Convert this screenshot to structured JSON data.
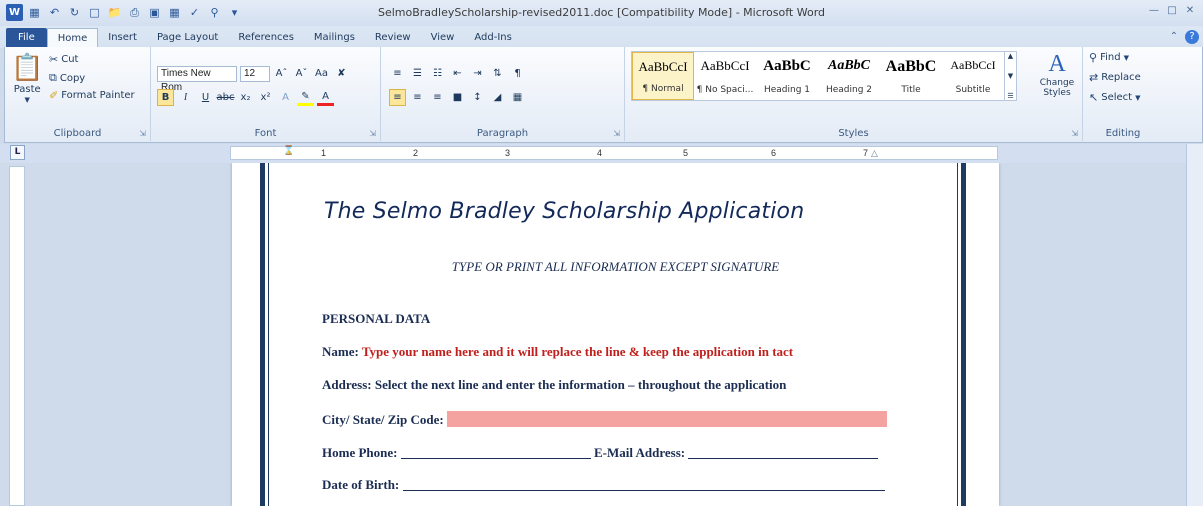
{
  "window": {
    "title": "SelmoBradleyScholarship-revised2011.doc [Compatibility Mode] - Microsoft Word",
    "app_icon_label": "W"
  },
  "tabs": [
    {
      "label": "File"
    },
    {
      "label": "Home"
    },
    {
      "label": "Insert"
    },
    {
      "label": "Page Layout"
    },
    {
      "label": "References"
    },
    {
      "label": "Mailings"
    },
    {
      "label": "Review"
    },
    {
      "label": "View"
    },
    {
      "label": "Add-Ins"
    }
  ],
  "clipboard": {
    "paste": "Paste",
    "cut": "Cut",
    "copy": "Copy",
    "format_painter": "Format Painter",
    "label": "Clipboard"
  },
  "font": {
    "family": "Times New Rom",
    "size": "12",
    "label": "Font"
  },
  "paragraph": {
    "label": "Paragraph"
  },
  "styles": {
    "items": [
      {
        "sample": "AaBbCcI",
        "name": "¶ Normal"
      },
      {
        "sample": "AaBbCcI",
        "name": "¶ No Spaci..."
      },
      {
        "sample": "AaBbC",
        "name": "Heading 1"
      },
      {
        "sample": "AaBbC",
        "name": "Heading 2"
      },
      {
        "sample": "AaBbC",
        "name": "Title"
      },
      {
        "sample": "AaBbCcI",
        "name": "Subtitle"
      }
    ],
    "change_styles": "Change Styles",
    "label": "Styles"
  },
  "editing": {
    "find": "Find",
    "replace": "Replace",
    "select": "Select",
    "label": "Editing"
  },
  "ruler": {
    "corner": "L",
    "numbers": [
      "1",
      "2",
      "3",
      "4",
      "5",
      "6",
      "7"
    ]
  },
  "document": {
    "title": "The Selmo Bradley Scholarship Application",
    "subtitle": "TYPE OR PRINT ALL INFORMATION EXCEPT SIGNATURE",
    "section": "PERSONAL DATA",
    "name_label": "Name:",
    "name_value": "Type your name here and it will replace the line & keep the application in tact",
    "address": "Address: Select the next line and enter the information – throughout the application",
    "city_label": "City/ State/ Zip Code:",
    "home_phone_label": "Home Phone:",
    "email_label": "E-Mail Address:",
    "dob_label": "Date of Birth:"
  }
}
